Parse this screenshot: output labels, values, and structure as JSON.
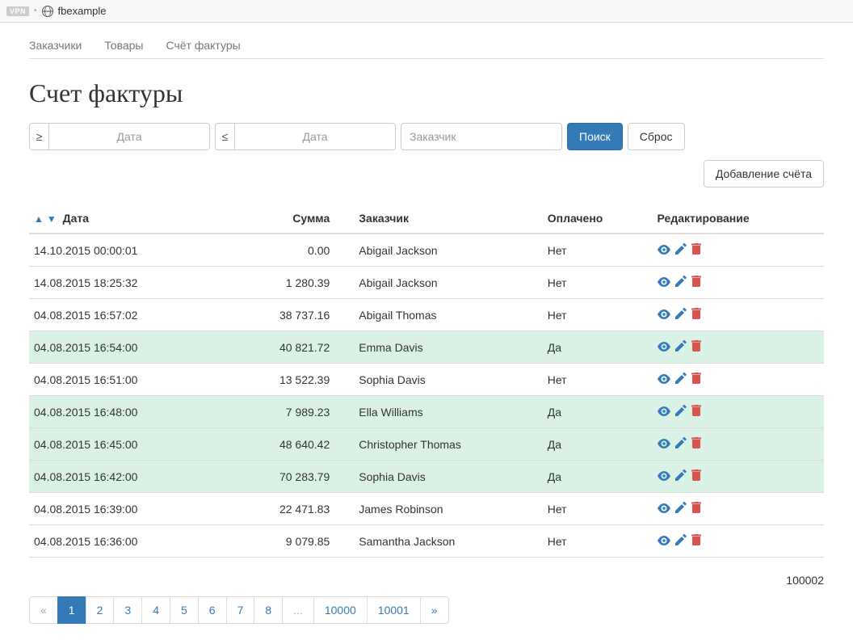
{
  "browser": {
    "vpn_label": "VPN",
    "url": "fbexample"
  },
  "nav": {
    "tabs": [
      {
        "label": "Заказчики"
      },
      {
        "label": "Товары"
      },
      {
        "label": "Счёт фактуры"
      }
    ]
  },
  "page_title": "Счет фактуры",
  "filters": {
    "gte_symbol": "≥",
    "lte_symbol": "≤",
    "date_placeholder": "Дата",
    "customer_placeholder": "Заказчик",
    "search_label": "Поиск",
    "reset_label": "Сброс"
  },
  "add_button_label": "Добавление счёта",
  "table": {
    "headers": {
      "date": "Дата",
      "sum": "Сумма",
      "customer": "Заказчик",
      "paid": "Оплачено",
      "edit": "Редактирование"
    },
    "rows": [
      {
        "date": "14.10.2015 00:00:01",
        "sum": "0.00",
        "customer": "Abigail Jackson",
        "paid": "Нет",
        "paid_flag": false
      },
      {
        "date": "14.08.2015 18:25:32",
        "sum": "1 280.39",
        "customer": "Abigail Jackson",
        "paid": "Нет",
        "paid_flag": false
      },
      {
        "date": "04.08.2015 16:57:02",
        "sum": "38 737.16",
        "customer": "Abigail Thomas",
        "paid": "Нет",
        "paid_flag": false
      },
      {
        "date": "04.08.2015 16:54:00",
        "sum": "40 821.72",
        "customer": "Emma Davis",
        "paid": "Да",
        "paid_flag": true
      },
      {
        "date": "04.08.2015 16:51:00",
        "sum": "13 522.39",
        "customer": "Sophia Davis",
        "paid": "Нет",
        "paid_flag": false
      },
      {
        "date": "04.08.2015 16:48:00",
        "sum": "7 989.23",
        "customer": "Ella Williams",
        "paid": "Да",
        "paid_flag": true
      },
      {
        "date": "04.08.2015 16:45:00",
        "sum": "48 640.42",
        "customer": "Christopher Thomas",
        "paid": "Да",
        "paid_flag": true
      },
      {
        "date": "04.08.2015 16:42:00",
        "sum": "70 283.79",
        "customer": "Sophia Davis",
        "paid": "Да",
        "paid_flag": true
      },
      {
        "date": "04.08.2015 16:39:00",
        "sum": "22 471.83",
        "customer": "James Robinson",
        "paid": "Нет",
        "paid_flag": false
      },
      {
        "date": "04.08.2015 16:36:00",
        "sum": "9 079.85",
        "customer": "Samantha Jackson",
        "paid": "Нет",
        "paid_flag": false
      }
    ]
  },
  "total_count": "100002",
  "pagination": {
    "prev": "«",
    "next": "»",
    "ellipsis": "...",
    "pages_left": [
      "1",
      "2",
      "3",
      "4",
      "5",
      "6",
      "7",
      "8"
    ],
    "pages_right": [
      "10000",
      "10001"
    ],
    "active": "1"
  }
}
